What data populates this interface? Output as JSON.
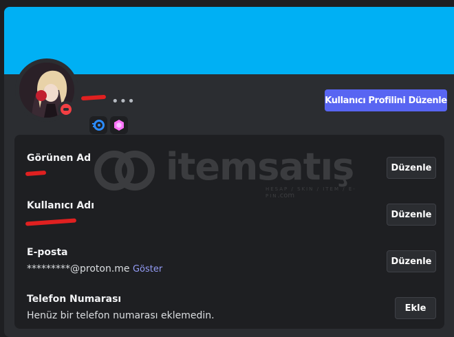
{
  "profile": {
    "edit_profile_button": "Kullanıcı Profilini Düzenle",
    "more_icon": "more-horizontal-icon",
    "status": "do-not-disturb",
    "badges": [
      "hypesquad-badge",
      "nitro-boost-badge"
    ],
    "banner_color": "#00b0f4"
  },
  "fields": [
    {
      "label": "Görünen Ad",
      "value": "",
      "button": "Düzenle"
    },
    {
      "label": "Kullanıcı Adı",
      "value": "",
      "button": "Düzenle"
    },
    {
      "label": "E-posta",
      "value": "*********@proton.me",
      "reveal": "Göster",
      "button": "Düzenle"
    },
    {
      "label": "Telefon Numarası",
      "value": "Henüz bir telefon numarası eklemedin.",
      "button": "Ekle"
    }
  ],
  "watermark": {
    "text": "itemsatış",
    "subtext": "HESAP / SKIN / ITEM / E-PIN",
    "domain": ".com"
  }
}
